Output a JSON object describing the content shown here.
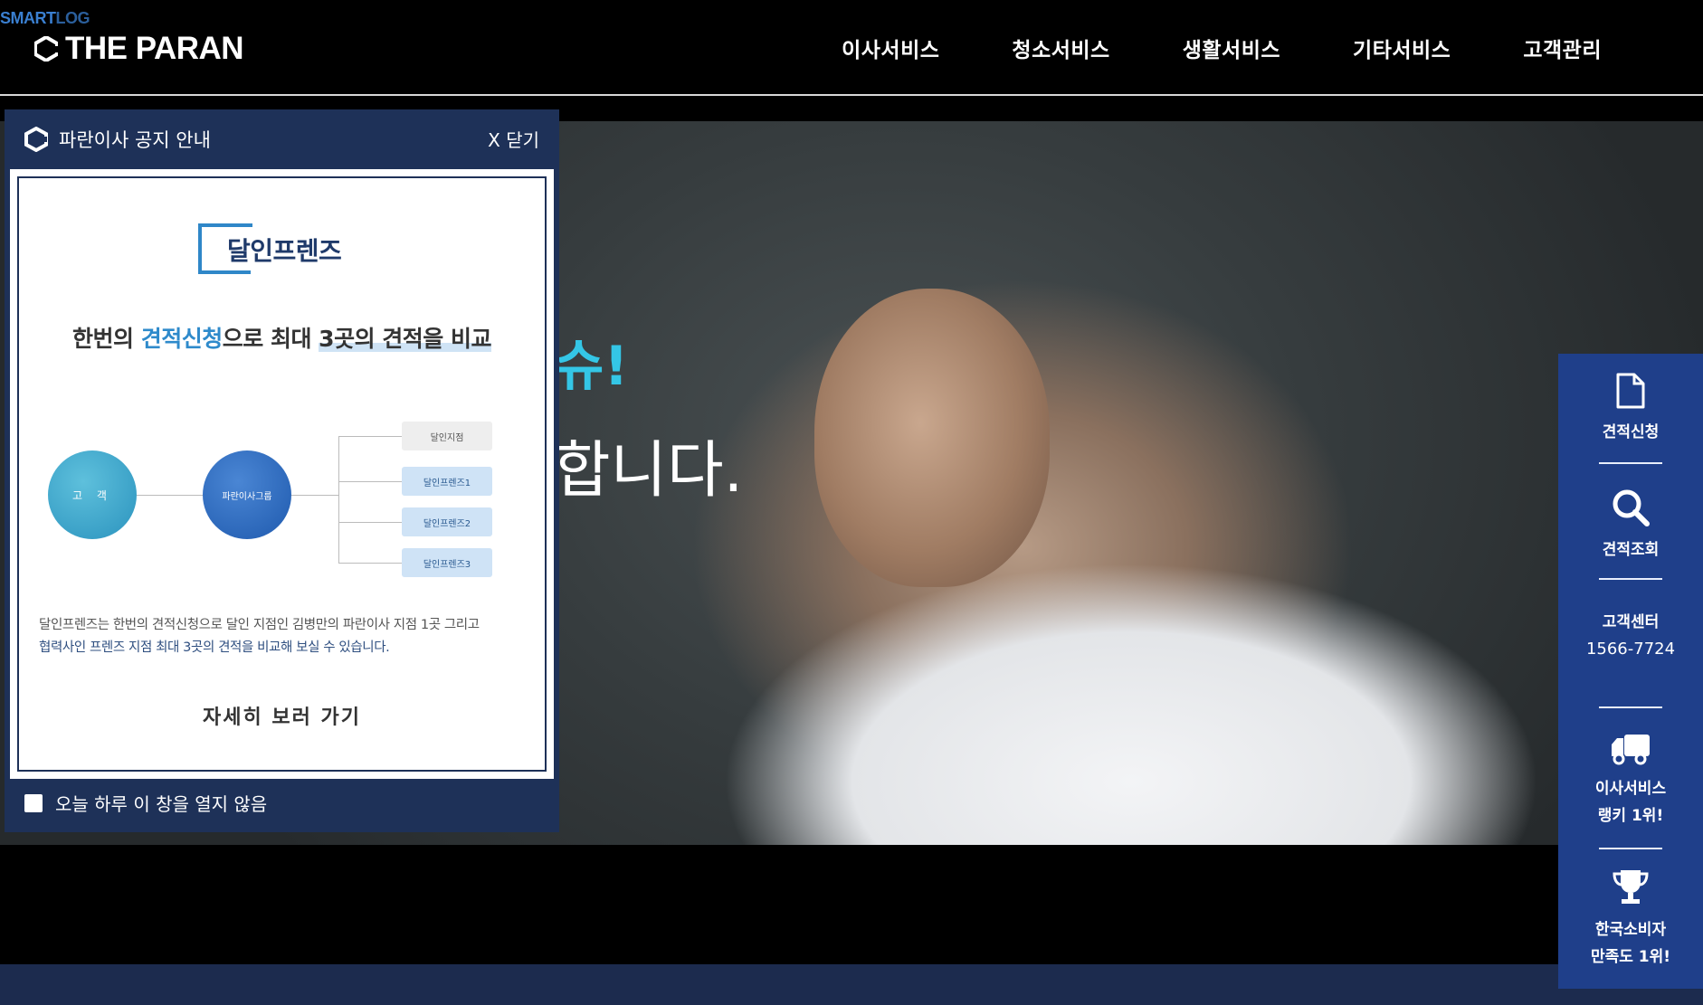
{
  "header": {
    "brand_small_1": "SMART",
    "brand_small_2": "LOG",
    "brand_main": "THE PARAN",
    "nav": [
      "이사서비스",
      "청소서비스",
      "생활서비스",
      "기타서비스",
      "고객관리"
    ]
  },
  "hero": {
    "line1": "슈!",
    "line2": "합니다."
  },
  "popup": {
    "title": "파란이사 공지 안내",
    "close_label": "X 닫기",
    "logo_name": "달인프렌즈",
    "headline_pre": "한번의 ",
    "headline_blue": "견적신청",
    "headline_mid": "으로 최대 ",
    "headline_under": "3곳의 견적을 비교",
    "diagram": {
      "customer": "고 객",
      "paran": "파란이사그룹",
      "boxes": [
        "달인지점",
        "달인프렌즈1",
        "달인프렌즈2",
        "달인프렌즈3"
      ]
    },
    "desc_line1": "달인프렌즈는 한번의 견적신청으로 달인 지점인 김병만의 파란이사 지점 1곳 그리고",
    "desc_line2": "협력사인 프렌즈 지점 최대 3곳의 견적을 비교해 보실 수 있습니다.",
    "detail_link": "자세히 보러 가기",
    "dont_show_label": "오늘 하루 이 창을 열지 않음"
  },
  "quick_menu": {
    "quote_request": "견적신청",
    "quote_lookup": "견적조회",
    "cs_title": "고객센터",
    "cs_phone": "1566-7724",
    "rank_1": "이사서비스",
    "rank_2": "랭키 1위!",
    "award_1": "한국소비자",
    "award_2": "만족도 1위!"
  },
  "colors": {
    "accent_blue": "#2e8acb",
    "popup_bg": "#1e3158",
    "quick_bg": "#1f3f8a",
    "hero_cyan": "#34c6e6"
  },
  "icons": [
    "paran-logo-icon",
    "document-icon",
    "search-icon",
    "truck-icon",
    "trophy-icon"
  ]
}
